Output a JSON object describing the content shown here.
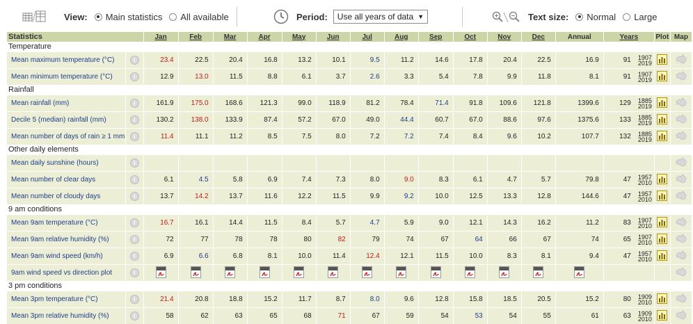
{
  "toolbar": {
    "view_label": "View:",
    "view_main": "Main statistics",
    "view_all": "All available",
    "period_label": "Period:",
    "period_value": "Use all years of data",
    "textsize_label": "Text size:",
    "textsize_normal": "Normal",
    "textsize_large": "Large"
  },
  "columns": [
    "Statistics",
    "Jan",
    "Feb",
    "Mar",
    "Apr",
    "May",
    "Jun",
    "Jul",
    "Aug",
    "Sep",
    "Oct",
    "Nov",
    "Dec",
    "Annual",
    "Years",
    "Plot",
    "Map"
  ],
  "rows": [
    {
      "section": "Temperature"
    },
    {
      "name": "Mean maximum temperature (°C)",
      "vals": [
        "23.4",
        "22.5",
        "20.4",
        "16.8",
        "13.2",
        "10.1",
        "9.5",
        "11.2",
        "14.6",
        "17.8",
        "20.4",
        "22.5"
      ],
      "hl": {
        "0": "red",
        "6": "blue"
      },
      "annual": "16.9",
      "years": "91",
      "y1": "1907",
      "y2": "2019",
      "plot": true,
      "map": true
    },
    {
      "name": "Mean minimum temperature (°C)",
      "vals": [
        "12.9",
        "13.0",
        "11.5",
        "8.8",
        "6.1",
        "3.7",
        "2.6",
        "3.3",
        "5.4",
        "7.8",
        "9.9",
        "11.8"
      ],
      "hl": {
        "1": "red",
        "6": "blue"
      },
      "annual": "8.1",
      "years": "91",
      "y1": "1907",
      "y2": "2019",
      "plot": true,
      "map": true
    },
    {
      "section": "Rainfall"
    },
    {
      "name": "Mean rainfall (mm)",
      "vals": [
        "161.9",
        "175.0",
        "168.6",
        "121.3",
        "99.0",
        "118.9",
        "81.2",
        "78.4",
        "71.4",
        "91.8",
        "109.6",
        "121.8"
      ],
      "hl": {
        "1": "red",
        "8": "blue"
      },
      "annual": "1399.6",
      "years": "129",
      "y1": "1885",
      "y2": "2019",
      "plot": true,
      "map": true
    },
    {
      "name": "Decile 5 (median) rainfall (mm)",
      "vals": [
        "130.2",
        "138.0",
        "133.9",
        "87.4",
        "57.2",
        "67.0",
        "49.0",
        "44.4",
        "60.7",
        "67.0",
        "88.6",
        "97.6"
      ],
      "hl": {
        "1": "red",
        "7": "blue"
      },
      "annual": "1375.6",
      "years": "133",
      "y1": "1885",
      "y2": "2019",
      "plot": true,
      "map": true
    },
    {
      "name": "Mean number of days of rain ≥ 1 mm",
      "vals": [
        "11.4",
        "11.1",
        "11.2",
        "8.5",
        "7.5",
        "8.0",
        "7.2",
        "7.2",
        "7.4",
        "8.4",
        "9.6",
        "10.2"
      ],
      "hl": {
        "0": "red",
        "7": "blue"
      },
      "annual": "107.7",
      "years": "132",
      "y1": "1885",
      "y2": "2019",
      "plot": true,
      "map": true
    },
    {
      "section": "Other daily elements"
    },
    {
      "name": "Mean daily sunshine (hours)",
      "vals": [
        "",
        "",
        "",
        "",
        "",
        "",
        "",
        "",
        "",
        "",
        "",
        ""
      ],
      "hl": {},
      "annual": "",
      "years": "",
      "y1": "",
      "y2": "",
      "plot": false,
      "map": true
    },
    {
      "name": "Mean number of clear days",
      "vals": [
        "6.1",
        "4.5",
        "5.8",
        "6.9",
        "7.4",
        "7.3",
        "8.0",
        "9.0",
        "8.3",
        "6.1",
        "4.7",
        "5.7"
      ],
      "hl": {
        "1": "blue",
        "7": "red"
      },
      "annual": "79.8",
      "years": "47",
      "y1": "1957",
      "y2": "2010",
      "plot": true,
      "map": true
    },
    {
      "name": "Mean number of cloudy days",
      "vals": [
        "13.7",
        "14.2",
        "13.7",
        "11.6",
        "12.2",
        "11.5",
        "9.9",
        "9.2",
        "10.0",
        "12.5",
        "13.3",
        "12.8"
      ],
      "hl": {
        "1": "red",
        "7": "blue"
      },
      "annual": "144.6",
      "years": "47",
      "y1": "1957",
      "y2": "2010",
      "plot": true,
      "map": true
    },
    {
      "section": "9 am conditions"
    },
    {
      "name": "Mean 9am temperature (°C)",
      "vals": [
        "16.7",
        "16.1",
        "14.4",
        "11.5",
        "8.4",
        "5.7",
        "4.7",
        "5.9",
        "9.0",
        "12.1",
        "14.3",
        "16.2"
      ],
      "hl": {
        "0": "red",
        "6": "blue"
      },
      "annual": "11.2",
      "years": "83",
      "y1": "1907",
      "y2": "2010",
      "plot": true,
      "map": true
    },
    {
      "name": "Mean 9am relative humidity (%)",
      "vals": [
        "72",
        "77",
        "78",
        "78",
        "80",
        "82",
        "79",
        "74",
        "67",
        "64",
        "66",
        "67"
      ],
      "hl": {
        "5": "red",
        "9": "blue"
      },
      "annual": "74",
      "years": "65",
      "y1": "1907",
      "y2": "2010",
      "plot": true,
      "map": true
    },
    {
      "name": "Mean 9am wind speed (km/h)",
      "vals": [
        "6.9",
        "6.6",
        "6.8",
        "8.1",
        "10.0",
        "11.4",
        "12.4",
        "12.1",
        "11.5",
        "10.0",
        "8.3",
        "8.1"
      ],
      "hl": {
        "1": "blue",
        "6": "red"
      },
      "annual": "9.4",
      "years": "47",
      "y1": "1957",
      "y2": "2010",
      "plot": true,
      "map": true
    },
    {
      "name": "9am wind speed vs direction plot",
      "pdf": true,
      "map": true
    },
    {
      "section": "3 pm conditions"
    },
    {
      "name": "Mean 3pm temperature (°C)",
      "vals": [
        "21.4",
        "20.8",
        "18.8",
        "15.2",
        "11.7",
        "8.7",
        "8.0",
        "9.6",
        "12.8",
        "15.8",
        "18.5",
        "20.5"
      ],
      "hl": {
        "0": "red",
        "6": "blue"
      },
      "annual": "15.2",
      "years": "80",
      "y1": "1909",
      "y2": "2010",
      "plot": true,
      "map": true
    },
    {
      "name": "Mean 3pm relative humidity (%)",
      "vals": [
        "58",
        "62",
        "63",
        "65",
        "68",
        "71",
        "67",
        "59",
        "54",
        "53",
        "54",
        "55"
      ],
      "hl": {
        "5": "red",
        "9": "blue"
      },
      "annual": "61",
      "years": "63",
      "y1": "1909",
      "y2": "2010",
      "plot": true,
      "map": true
    }
  ]
}
